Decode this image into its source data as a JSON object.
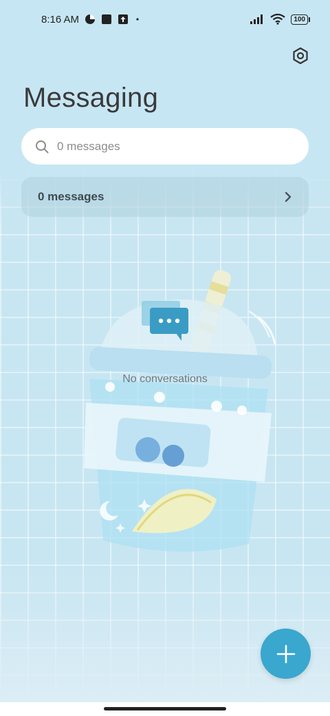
{
  "status_bar": {
    "time": "8:16 AM",
    "battery": "100"
  },
  "icons": {
    "settings": "gear-hexagon-icon",
    "search": "search-icon",
    "chevron": "chevron-right-icon",
    "chat": "chat-bubble-icon",
    "fab": "plus-icon"
  },
  "header": {
    "title": "Messaging"
  },
  "search": {
    "placeholder": "0 messages"
  },
  "messages_row": {
    "label": "0 messages"
  },
  "empty_state": {
    "text": "No conversations"
  },
  "colors": {
    "background": "#c8e6f2",
    "accent": "#3aa7cf",
    "chat_icon": "#3a9cc4"
  }
}
